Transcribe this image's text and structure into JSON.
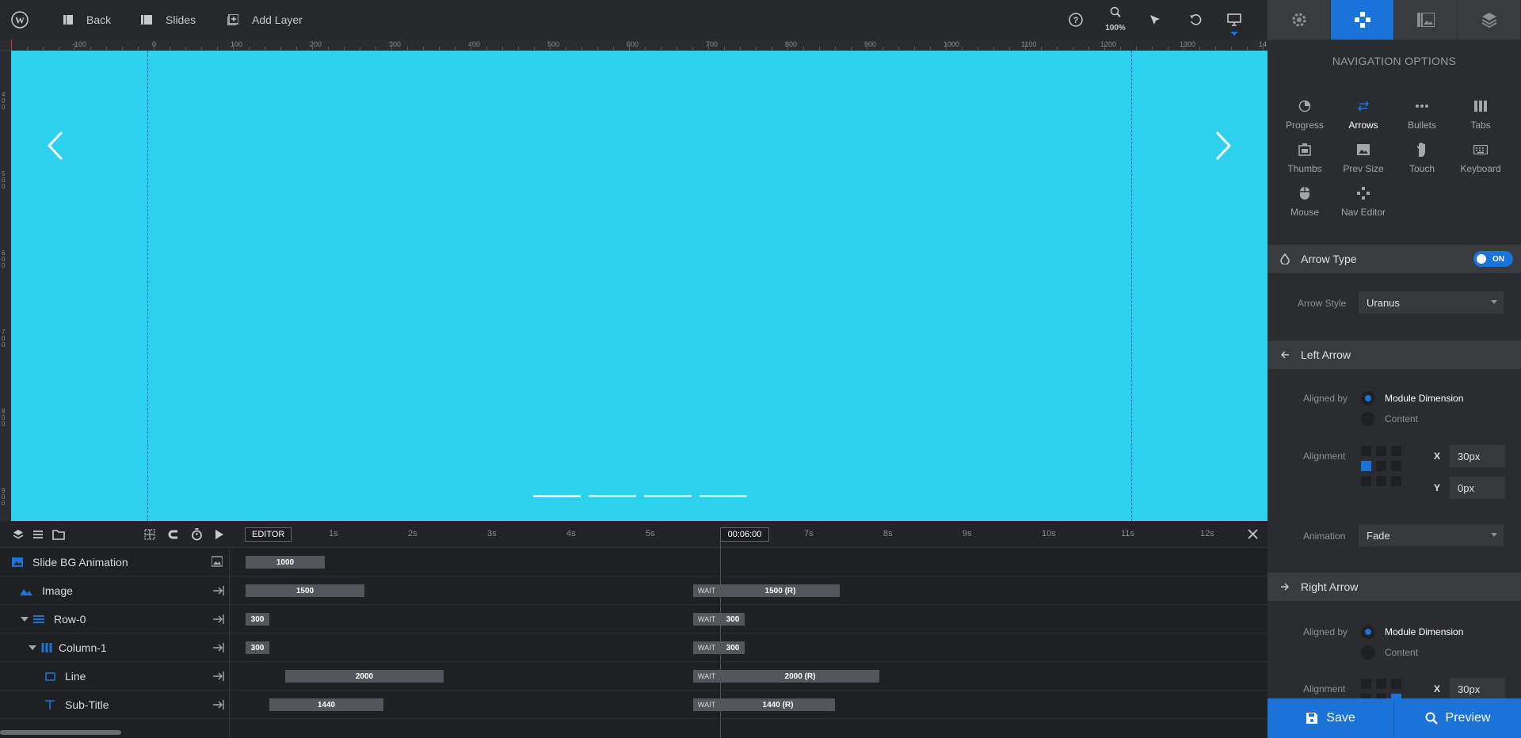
{
  "topbar": {
    "back_label": "Back",
    "slides_label": "Slides",
    "add_layer_label": "Add Layer",
    "zoom_label": "100%"
  },
  "ruler": {
    "h_labels": [
      "-100",
      "0",
      "100",
      "200",
      "300",
      "400",
      "500",
      "600",
      "700",
      "800",
      "900",
      "1000",
      "1100",
      "1200",
      "1300",
      "14"
    ],
    "v_labels": [
      "400",
      "500",
      "600",
      "700",
      "800",
      "900"
    ]
  },
  "canvas": {
    "background": "#2dd1ee",
    "bullets_count": 4,
    "active_bullet": 1
  },
  "timeline": {
    "editor_label": "EDITOR",
    "playhead_time": "00:06:00",
    "seconds": [
      "1s",
      "2s",
      "3s",
      "4s",
      "5s",
      "7s",
      "8s",
      "9s",
      "10s",
      "11s",
      "12s"
    ],
    "wait_label": "WAIT",
    "rows": [
      {
        "name": "Slide BG Animation",
        "in_value": "1000",
        "out_value": ""
      },
      {
        "name": "Image",
        "in_value": "1500",
        "out_value": "1500 (R)"
      },
      {
        "name": "Row-0",
        "in_value": "300",
        "out_value": "300"
      },
      {
        "name": "Column-1",
        "in_value": "300",
        "out_value": "300"
      },
      {
        "name": "Line",
        "in_value": "2000",
        "out_value": "2000 (R)"
      },
      {
        "name": "Sub-Title",
        "in_value": "1440",
        "out_value": "1440 (R)"
      }
    ]
  },
  "panel": {
    "title": "NAVIGATION OPTIONS",
    "nav_items": [
      "Progress",
      "Arrows",
      "Bullets",
      "Tabs",
      "Thumbs",
      "Prev Size",
      "Touch",
      "Keyboard",
      "Mouse",
      "Nav Editor"
    ],
    "active_nav": "Arrows",
    "arrow_type": {
      "label": "Arrow Type",
      "toggle": "ON",
      "style_label": "Arrow Style",
      "style_value": "Uranus"
    },
    "left_arrow": {
      "label": "Left Arrow",
      "aligned_by_label": "Aligned by",
      "option_1": "Module Dimension",
      "option_2": "Content",
      "alignment_label": "Alignment",
      "x_label": "X",
      "x_value": "30px",
      "y_label": "Y",
      "y_value": "0px",
      "animation_label": "Animation",
      "animation_value": "Fade"
    },
    "right_arrow": {
      "label": "Right Arrow",
      "aligned_by_label": "Aligned by",
      "option_1": "Module Dimension",
      "option_2": "Content",
      "alignment_label": "Alignment",
      "x_label": "X",
      "x_value": "30px"
    }
  },
  "buttons": {
    "save": "Save",
    "preview": "Preview"
  },
  "colors": {
    "accent": "#1a73d9",
    "canvas": "#2dd1ee",
    "panel": "#2b2c2f"
  }
}
